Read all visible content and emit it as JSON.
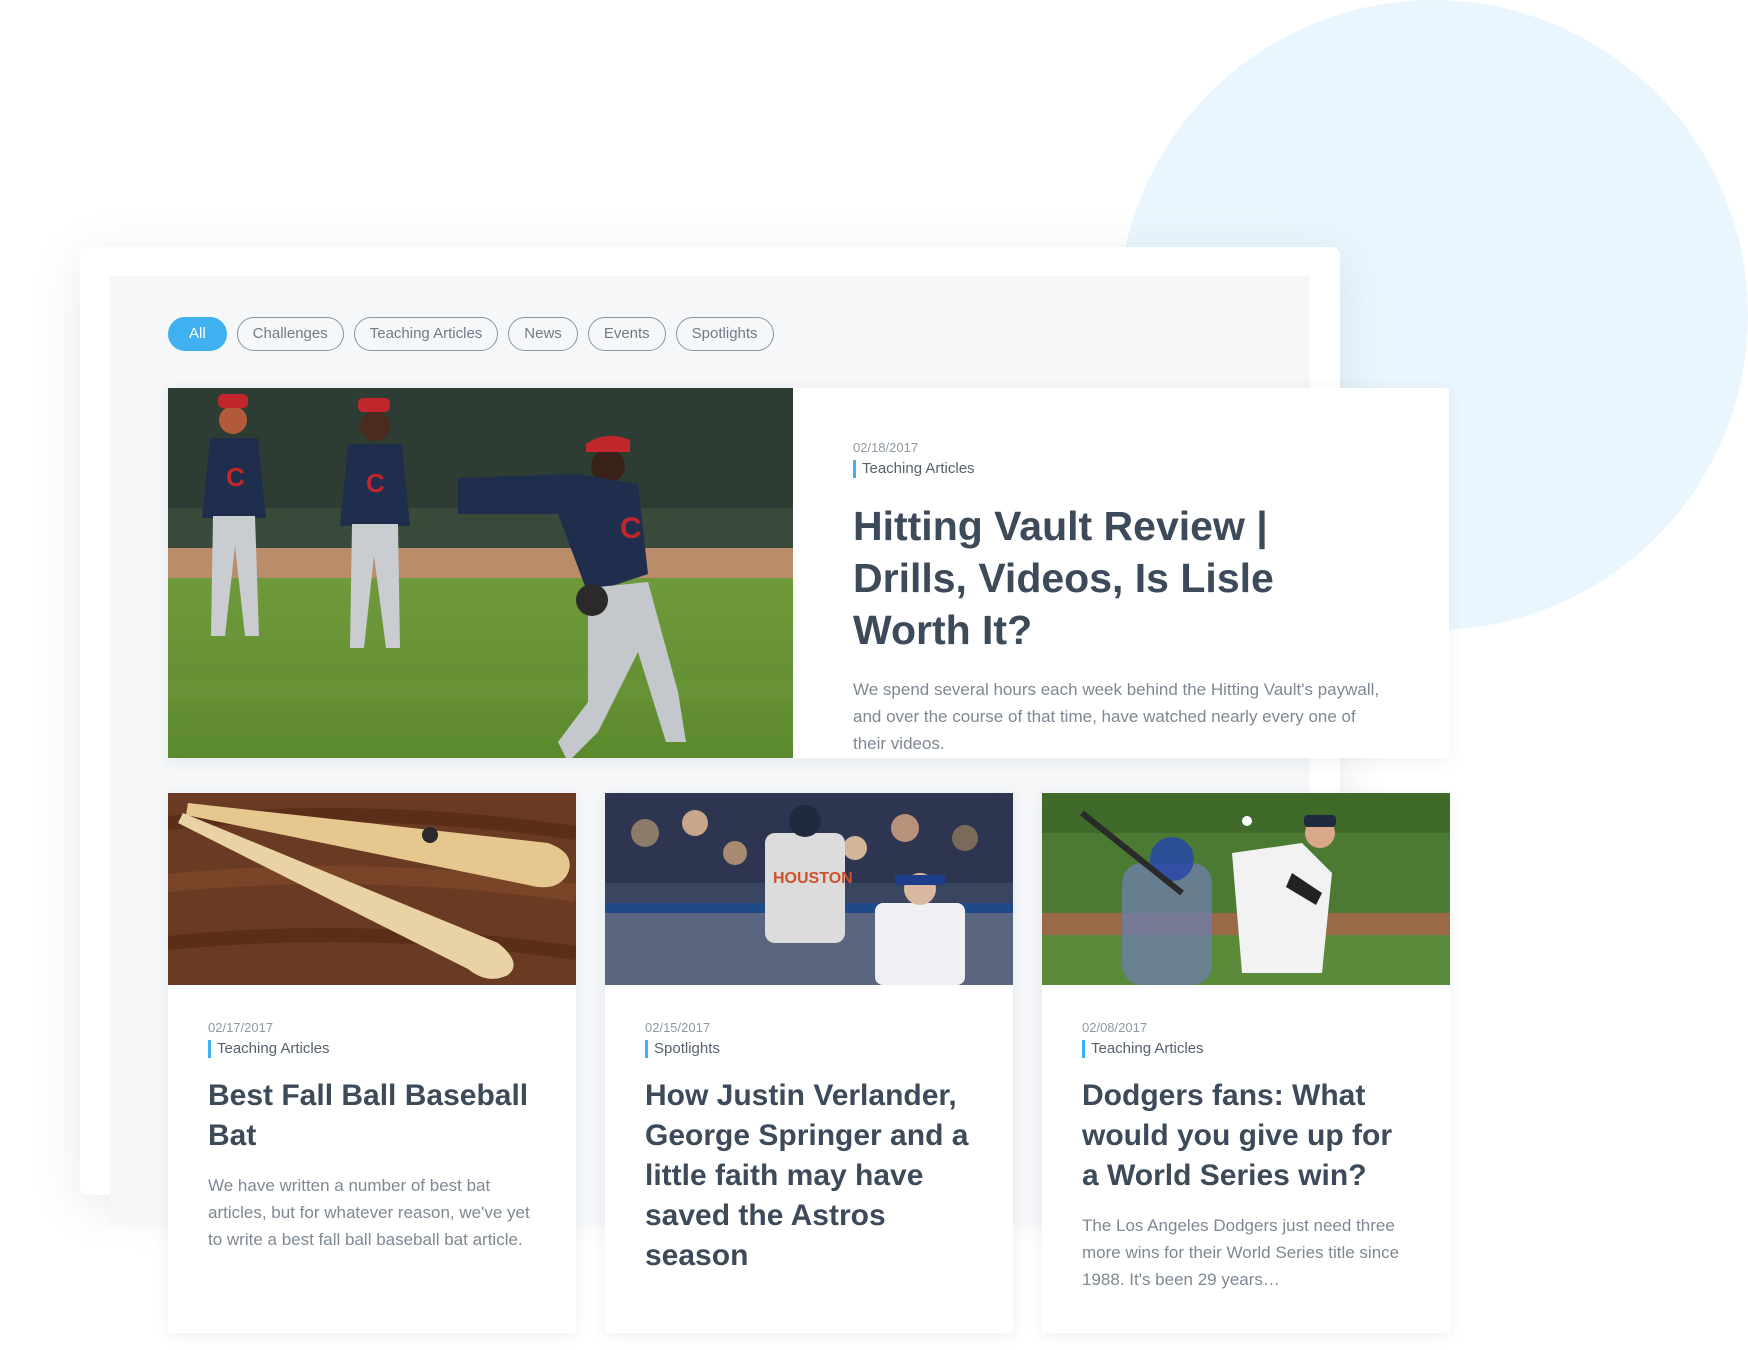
{
  "filters": {
    "items": [
      {
        "label": "All",
        "active": true
      },
      {
        "label": "Challenges",
        "active": false
      },
      {
        "label": "Teaching Articles",
        "active": false
      },
      {
        "label": "News",
        "active": false
      },
      {
        "label": "Events",
        "active": false
      },
      {
        "label": "Spotlights",
        "active": false
      }
    ]
  },
  "featured": {
    "date": "02/18/2017",
    "category": "Teaching Articles",
    "title": "Hitting Vault Review | Drills, Videos, Is Lisle Worth It?",
    "excerpt": "We spend several hours each week behind the Hitting Vault's paywall, and over the course of that time, have watched nearly every one of their videos."
  },
  "cards": [
    {
      "date": "02/17/2017",
      "category": "Teaching Articles",
      "title": "Best Fall Ball Baseball Bat",
      "excerpt": "We have written a number of best bat articles, but for whatever reason, we've yet to write a best fall ball baseball bat article."
    },
    {
      "date": "02/15/2017",
      "category": "Spotlights",
      "title": "How Justin Verlander, George Springer and a little faith may have saved the Astros season",
      "excerpt": ""
    },
    {
      "date": "02/08/2017",
      "category": "Teaching Articles",
      "title": "Dodgers fans: What would you give up for a World Series win?",
      "excerpt": "The Los Angeles Dodgers just need three more wins for their World Series title since 1988. It's been 29 years…"
    }
  ],
  "colors": {
    "accent": "#3fb0f0",
    "heading": "#3d4a59",
    "background_circle": "#eaf6fd"
  }
}
